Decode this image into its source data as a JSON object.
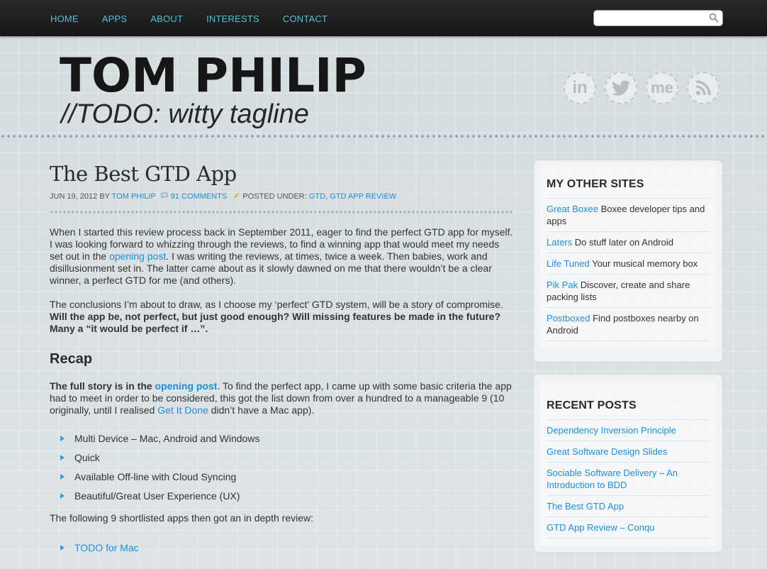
{
  "nav": {
    "items": [
      "HOME",
      "APPS",
      "ABOUT",
      "INTERESTS",
      "CONTACT"
    ],
    "link_color": "#4fc3d4"
  },
  "search": {
    "placeholder": "",
    "icon": "search-icon"
  },
  "header": {
    "title": "TOM PHILIP",
    "tagline": "//TODO: witty tagline",
    "social_icons": [
      "linkedin-icon",
      "twitter-icon",
      "aboutme-icon",
      "rss-icon"
    ],
    "social_labels": [
      "in",
      "me"
    ]
  },
  "post": {
    "title": "The Best GTD App",
    "meta": {
      "date": "JUN 19, 2012",
      "by": "BY",
      "author": "TOM PHILIP",
      "comments": "91 COMMENTS",
      "posted_under": "POSTED UNDER:",
      "cat1": "GTD",
      "sep": ",",
      "cat2": "GTD APP REVIEW"
    },
    "p1": {
      "a": "When I started this review process back in September 2011, eager to find the perfect GTD app for myself. I was looking forward to whizzing through the reviews, to find a winning app that would meet my needs set out in the ",
      "link": "opening post",
      "b": ". I was writing the reviews, at times, twice a week. Then babies, work and disillusionment set in. The latter came about as it slowly dawned on me that there wouldn’t be a clear winner, a perfect GTD for me (and others)."
    },
    "p2": {
      "a": "The conclusions I’m about to draw, as I choose my ‘perfect’ GTD system, will be a story of compromise. ",
      "bold": "Will the app be, not perfect, but just good enough? Will missing features be made in the future? Many a “it would be perfect if …”."
    },
    "recap": "Recap",
    "p3": {
      "bold": "The full story is in the ",
      "bold_link": "opening post",
      "a": ". To find the perfect app, I came up with some basic criteria the app had to meet in order to be considered, this got the list down from over a hundred to a manageable 9 (10 originally, until I realised ",
      "link": "Get It Done",
      "b": " didn’t have a Mac app)."
    },
    "criteria": [
      "Multi Device – Mac, Android and Windows",
      "Quick",
      "Available Off-line with Cloud Syncing",
      "Beautiful/Great User Experience (UX)"
    ],
    "p4": "The following 9 shortlisted apps then got an in depth review:",
    "apps": [
      "TODO for Mac"
    ]
  },
  "sidebar": {
    "other_sites": {
      "title": "MY OTHER SITES",
      "items": [
        {
          "name": "Great Boxee",
          "desc": " Boxee developer tips and apps"
        },
        {
          "name": "Laters",
          "desc": " Do stuff later on Android"
        },
        {
          "name": "Life Tuned",
          "desc": " Your musical memory box"
        },
        {
          "name": "Pik Pak",
          "desc": " Discover, create and share packing lists"
        },
        {
          "name": "Postboxed",
          "desc": " Find postboxes nearby on Android"
        }
      ]
    },
    "recent_posts": {
      "title": "RECENT POSTS",
      "items": [
        "Dependency Inversion Principle",
        "Great Software Design Slides",
        "Sociable Software Delivery – An Introduction to BDD",
        "The Best GTD App",
        "GTD App Review – Conqu"
      ]
    }
  },
  "colors": {
    "link": "#1e8fd6",
    "topbar": "#1b1b1b",
    "background": "#d7dee2"
  }
}
